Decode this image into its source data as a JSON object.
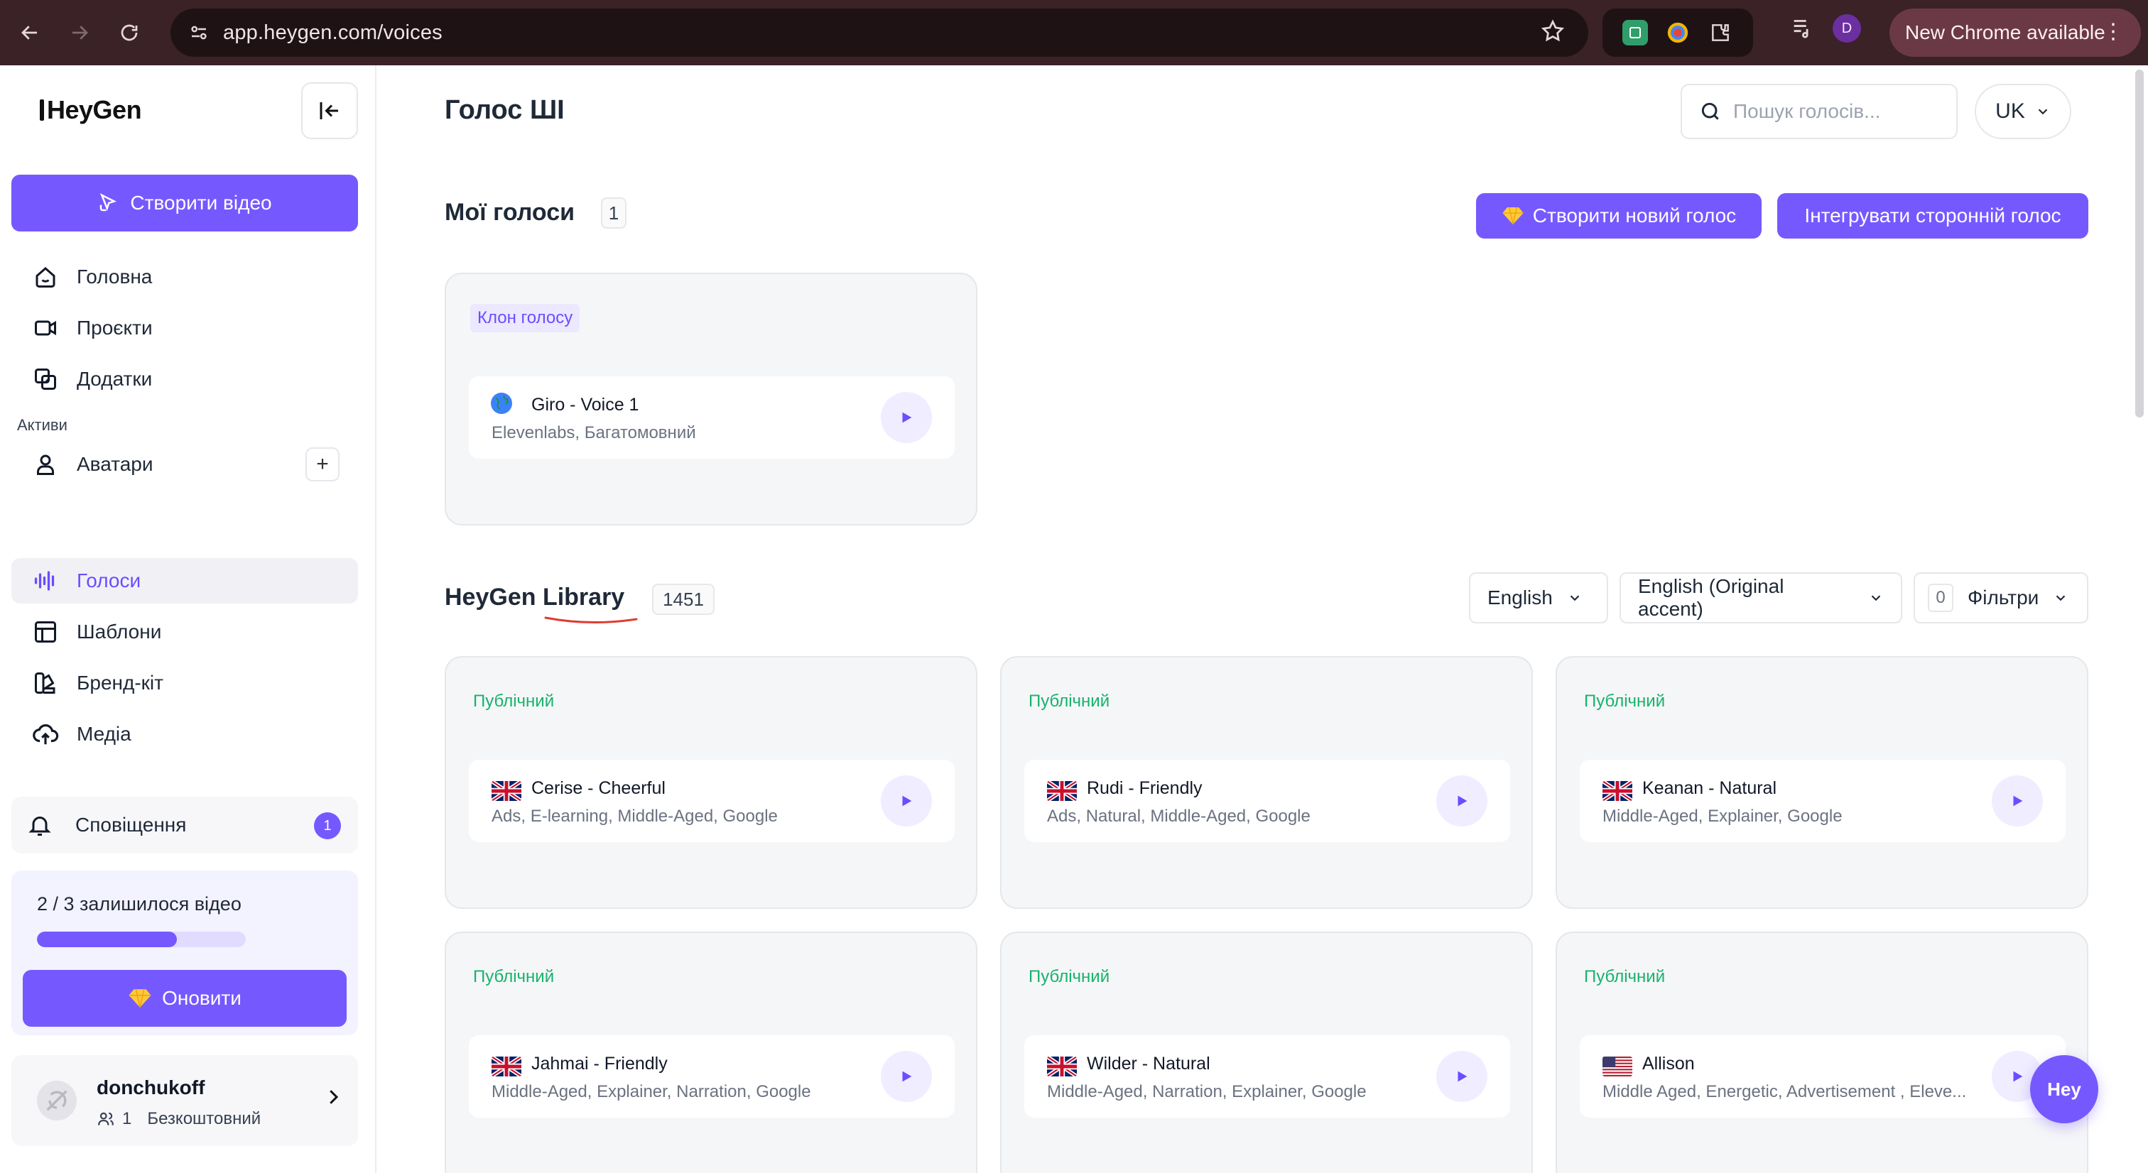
{
  "browser": {
    "url": "app.heygen.com/voices",
    "profile_initial": "D",
    "update_label": "New Chrome available"
  },
  "sidebar": {
    "logo": "HeyGen",
    "create_video": "Створити відео",
    "nav": [
      {
        "label": "Головна",
        "icon": "home-icon"
      },
      {
        "label": "Проєкти",
        "icon": "video-camera-icon"
      },
      {
        "label": "Додатки",
        "icon": "apps-icon"
      }
    ],
    "assets_label": "Активи",
    "assets": [
      {
        "label": "Аватари",
        "icon": "user-icon"
      },
      {
        "label": "Голоси",
        "icon": "waveform-icon",
        "active": true
      },
      {
        "label": "Шаблони",
        "icon": "template-icon"
      },
      {
        "label": "Бренд-кіт",
        "icon": "brand-kit-icon"
      },
      {
        "label": "Медіа",
        "icon": "cloud-upload-icon"
      }
    ],
    "notifications": {
      "label": "Сповіщення",
      "count": "1"
    },
    "plan": {
      "text": "2 / 3 залишилося відео",
      "progress": 0.67,
      "upgrade": "Оновити"
    },
    "user": {
      "name": "donchukoff",
      "seats": "1",
      "plan": "Безкоштовний"
    }
  },
  "main": {
    "title": "Голос ШІ",
    "search_placeholder": "Пошук голосів...",
    "language": "UK",
    "my_voices": {
      "title": "Мої голоси",
      "count": "1",
      "create_button": "Створити новий голос",
      "integrate_button": "Інтегрувати сторонній голос",
      "cards": [
        {
          "tag": "Клон голосу",
          "name": "Giro - Voice 1",
          "meta": "Elevenlabs, Багатомовний",
          "flag": "globe"
        }
      ]
    },
    "library": {
      "title": "HeyGen Library",
      "count": "1451",
      "language_filter": "English",
      "accent_filter": "English (Original accent)",
      "filters_count": "0",
      "filters_label": "Фільтри",
      "cards": [
        {
          "tag": "Публічний",
          "name": "Cerise - Cheerful",
          "meta": "Ads, E-learning, Middle-Aged, Google",
          "flag": "uk"
        },
        {
          "tag": "Публічний",
          "name": "Rudi - Friendly",
          "meta": "Ads, Natural, Middle-Aged, Google",
          "flag": "uk"
        },
        {
          "tag": "Публічний",
          "name": "Keanan - Natural",
          "meta": "Middle-Aged, Explainer, Google",
          "flag": "uk"
        },
        {
          "tag": "Публічний",
          "name": "Jahmai - Friendly",
          "meta": "Middle-Aged, Explainer, Narration, Google",
          "flag": "uk"
        },
        {
          "tag": "Публічний",
          "name": "Wilder - Natural",
          "meta": "Middle-Aged, Narration, Explainer, Google",
          "flag": "uk"
        },
        {
          "tag": "Публічний",
          "name": "Allison",
          "meta": "Middle Aged, Energetic, Advertisement , Eleve...",
          "flag": "us"
        }
      ]
    },
    "chat_bubble": "Hey"
  },
  "colors": {
    "accent": "#7559ff",
    "public_tag": "#16b36b",
    "chrome_bar": "#3a2227"
  }
}
